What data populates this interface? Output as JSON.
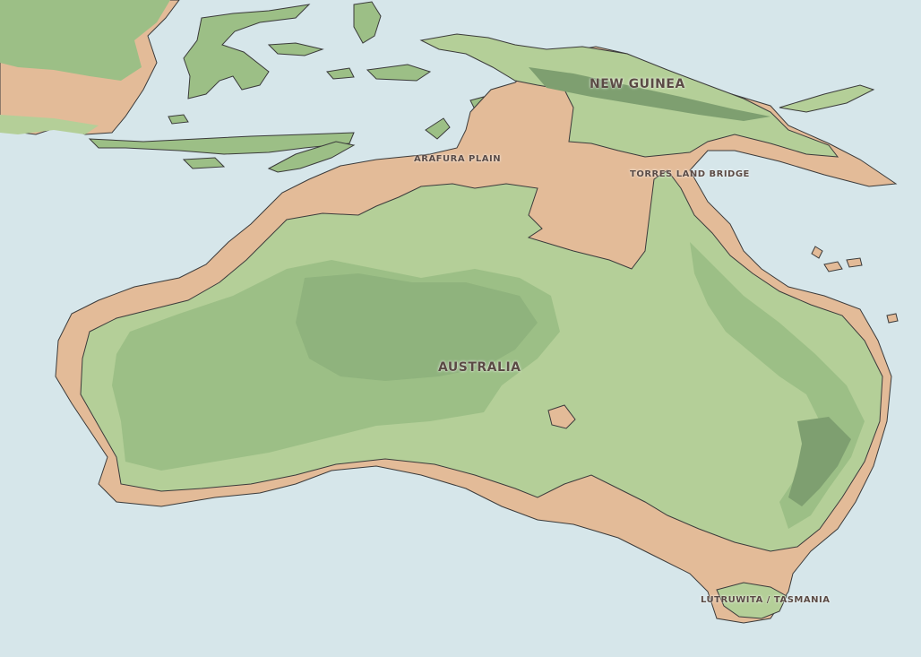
{
  "map": {
    "labels": {
      "australia": "AUSTRALIA",
      "new_guinea": "NEW GUINEA",
      "arafura_plain": "ARAFURA PLAIN",
      "torres_land_bridge": "TORRES LAND BRIDGE",
      "tasmania": "LUTRUWITA / TASMANIA"
    },
    "colors": {
      "ocean": "#d6e6ea",
      "exposed_shelf": "#e3bb98",
      "lowland": "#b4cf98",
      "midland": "#9cbf86",
      "highland": "#8fb37d",
      "mountain": "#7e9f70",
      "coastline": "#3b3b3b",
      "label_text": "#5a4a44"
    }
  }
}
